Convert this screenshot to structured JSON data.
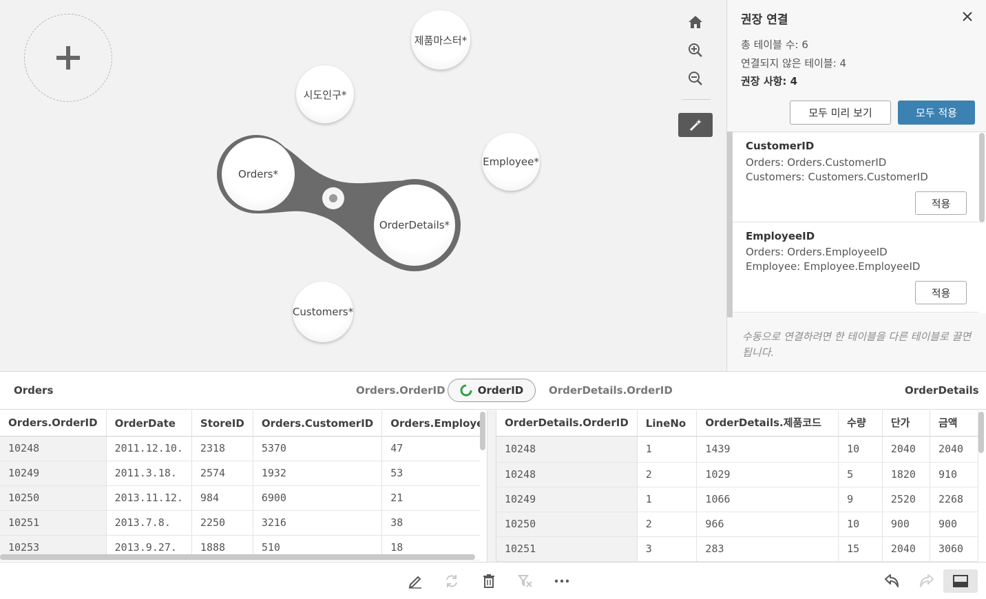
{
  "canvas": {
    "tables": {
      "product_master": "제품마스터*",
      "sido_population": "시도인구*",
      "orders": "Orders*",
      "order_details": "OrderDetails*",
      "employee": "Employee*",
      "customers": "Customers*"
    },
    "icons": [
      "plus-icon",
      "home-icon",
      "zoom-in-icon",
      "zoom-out-icon",
      "magic-wand-icon"
    ]
  },
  "panel": {
    "title": "권장 연결",
    "total_tables": "총 테이블 수: 6",
    "unlinked_tables": "연결되지 않은 테이블: 4",
    "recommendations_label": "권장 사항: 4",
    "preview_all": "모두 미리 보기",
    "apply_all": "모두 적용",
    "recommendations": [
      {
        "name": "CustomerID",
        "line1": "Orders: Orders.CustomerID",
        "line2": "Customers: Customers.CustomerID",
        "apply": "적용"
      },
      {
        "name": "EmployeeID",
        "line1": "Orders: Orders.EmployeeID",
        "line2": "Employee: Employee.EmployeeID",
        "apply": "적용"
      }
    ],
    "hint": "수동으로 연결하려면 한 테이블을 다른 테이블로 끌면 됩니다."
  },
  "association": {
    "left_table": "Orders",
    "left_field": "Orders.OrderID",
    "key": "OrderID",
    "right_field": "OrderDetails.OrderID",
    "right_table": "OrderDetails"
  },
  "left_table": {
    "headers": [
      "Orders.OrderID",
      "OrderDate",
      "StoreID",
      "Orders.CustomerID",
      "Orders.EmployeeID"
    ],
    "rows": [
      [
        "10248",
        "2011.12.10.",
        "2318",
        "5370",
        "47"
      ],
      [
        "10249",
        "2011.3.18.",
        "2574",
        "1932",
        "53"
      ],
      [
        "10250",
        "2013.11.12.",
        "984",
        "6900",
        "21"
      ],
      [
        "10251",
        "2013.7.8.",
        "2250",
        "3216",
        "38"
      ],
      [
        "10253",
        "2013.9.27.",
        "1888",
        "510",
        "18"
      ]
    ]
  },
  "right_table": {
    "headers": [
      "OrderDetails.OrderID",
      "LineNo",
      "OrderDetails.제품코드",
      "수량",
      "단가",
      "금액"
    ],
    "rows": [
      [
        "10248",
        "1",
        "1439",
        "10",
        "2040",
        "2040"
      ],
      [
        "10248",
        "2",
        "1029",
        "5",
        "1820",
        "910"
      ],
      [
        "10249",
        "1",
        "1066",
        "9",
        "2520",
        "2268"
      ],
      [
        "10250",
        "2",
        "966",
        "10",
        "900",
        "900"
      ],
      [
        "10251",
        "3",
        "283",
        "15",
        "2040",
        "3060"
      ]
    ]
  },
  "footer": {
    "icons": [
      "edit-icon",
      "refresh-icon",
      "delete-icon",
      "clear-filter-icon",
      "more-icon",
      "undo-icon",
      "redo-icon",
      "preview-panel-icon"
    ]
  },
  "colors": {
    "accent": "#3b81b2",
    "link_gray": "#6a6a6a",
    "canvas_bg": "#f2f2f2"
  }
}
